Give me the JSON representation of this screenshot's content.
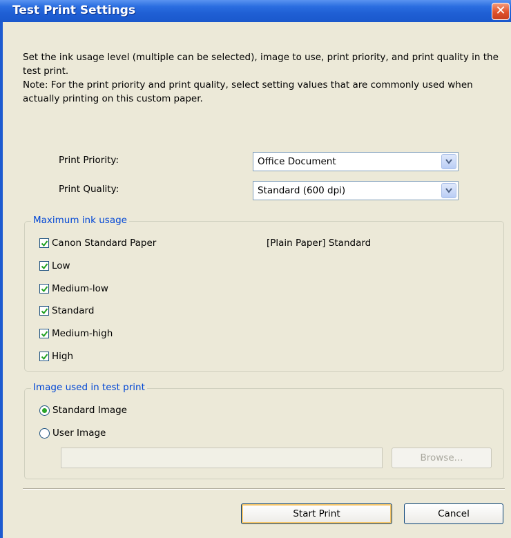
{
  "window": {
    "title": "Test Print Settings",
    "close_symbol": "✕"
  },
  "description": {
    "line1": "Set the ink usage level (multiple can be selected), image to use, print priority, and print quality in the test print.",
    "line2": "Note: For the print priority and print quality, select setting values that are commonly used when actually printing on this custom paper."
  },
  "print_priority": {
    "label": "Print Priority:",
    "value": "Office Document"
  },
  "print_quality": {
    "label": "Print Quality:",
    "value": "Standard (600 dpi)"
  },
  "ink_usage": {
    "legend": "Maximum ink usage",
    "paper_info": "[Plain Paper] Standard",
    "items": [
      {
        "label": "Canon Standard Paper",
        "checked": true
      },
      {
        "label": "Low",
        "checked": true
      },
      {
        "label": "Medium-low",
        "checked": true
      },
      {
        "label": "Standard",
        "checked": true
      },
      {
        "label": "Medium-high",
        "checked": true
      },
      {
        "label": "High",
        "checked": true
      }
    ]
  },
  "image_group": {
    "legend": "Image used in test print",
    "options": [
      {
        "label": "Standard Image",
        "selected": true
      },
      {
        "label": "User Image",
        "selected": false
      }
    ],
    "path_value": "",
    "browse_label": "Browse..."
  },
  "buttons": {
    "start_print": "Start Print",
    "cancel": "Cancel"
  },
  "colors": {
    "titlebar": "#1f5fd4",
    "dialog_bg": "#ece9d8",
    "legend_text": "#0046d5",
    "check_mark": "#21a121"
  }
}
